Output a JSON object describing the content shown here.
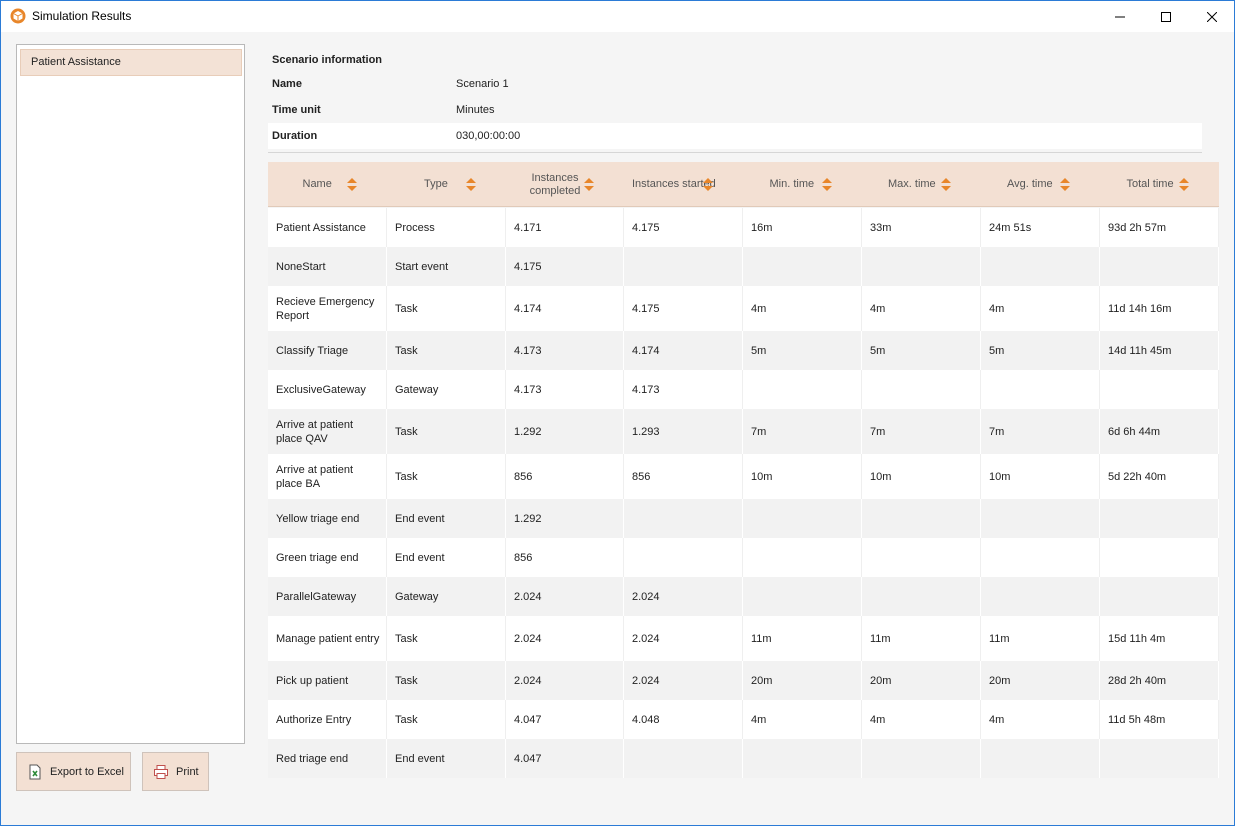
{
  "window": {
    "title": "Simulation Results"
  },
  "sidebar": {
    "items": [
      {
        "label": "Patient Assistance"
      }
    ]
  },
  "buttons": {
    "export_label": "Export to Excel",
    "print_label": "Print"
  },
  "scenario": {
    "heading": "Scenario information",
    "rows": [
      {
        "key": "Name",
        "value": "Scenario 1"
      },
      {
        "key": "Time unit",
        "value": "Minutes"
      },
      {
        "key": "Duration",
        "value": "030,00:00:00"
      }
    ]
  },
  "table": {
    "columns": [
      "Name",
      "Type",
      "Instances completed",
      "Instances started",
      "Min. time",
      "Max. time",
      "Avg. time",
      "Total time"
    ],
    "rows": [
      [
        "Patient Assistance",
        "Process",
        "4.171",
        "4.175",
        "16m",
        "33m",
        "24m 51s",
        "93d 2h 57m"
      ],
      [
        "NoneStart",
        "Start event",
        "4.175",
        "",
        "",
        "",
        "",
        ""
      ],
      [
        "Recieve Emergency Report",
        "Task",
        "4.174",
        "4.175",
        "4m",
        "4m",
        "4m",
        "11d 14h 16m"
      ],
      [
        "Classify Triage",
        "Task",
        "4.173",
        "4.174",
        "5m",
        "5m",
        "5m",
        "14d 11h 45m"
      ],
      [
        "ExclusiveGateway",
        "Gateway",
        "4.173",
        "4.173",
        "",
        "",
        "",
        ""
      ],
      [
        "Arrive at patient place QAV",
        "Task",
        "1.292",
        "1.293",
        "7m",
        "7m",
        "7m",
        "6d 6h 44m"
      ],
      [
        "Arrive at patient place BA",
        "Task",
        "856",
        "856",
        "10m",
        "10m",
        "10m",
        "5d 22h 40m"
      ],
      [
        "Yellow triage end",
        "End event",
        "1.292",
        "",
        "",
        "",
        "",
        ""
      ],
      [
        "Green triage end",
        "End event",
        "856",
        "",
        "",
        "",
        "",
        ""
      ],
      [
        "ParallelGateway",
        "Gateway",
        "2.024",
        "2.024",
        "",
        "",
        "",
        ""
      ],
      [
        "Manage patient entry",
        "Task",
        "2.024",
        "2.024",
        "11m",
        "11m",
        "11m",
        "15d 11h 4m"
      ],
      [
        "Pick up patient",
        "Task",
        "2.024",
        "2.024",
        "20m",
        "20m",
        "20m",
        "28d 2h 40m"
      ],
      [
        "Authorize Entry",
        "Task",
        "4.047",
        "4.048",
        "4m",
        "4m",
        "4m",
        "11d 5h 48m"
      ],
      [
        "Red triage end",
        "End event",
        "4.047",
        "",
        "",
        "",
        "",
        ""
      ]
    ]
  },
  "icons": {
    "app": "cube-icon",
    "sort": "sort-arrows-icon",
    "excel": "excel-icon",
    "print": "printer-icon"
  },
  "colors": {
    "header_bg": "#f3e0d3",
    "accent": "#e8862a",
    "selected": "#f3e2d6"
  }
}
